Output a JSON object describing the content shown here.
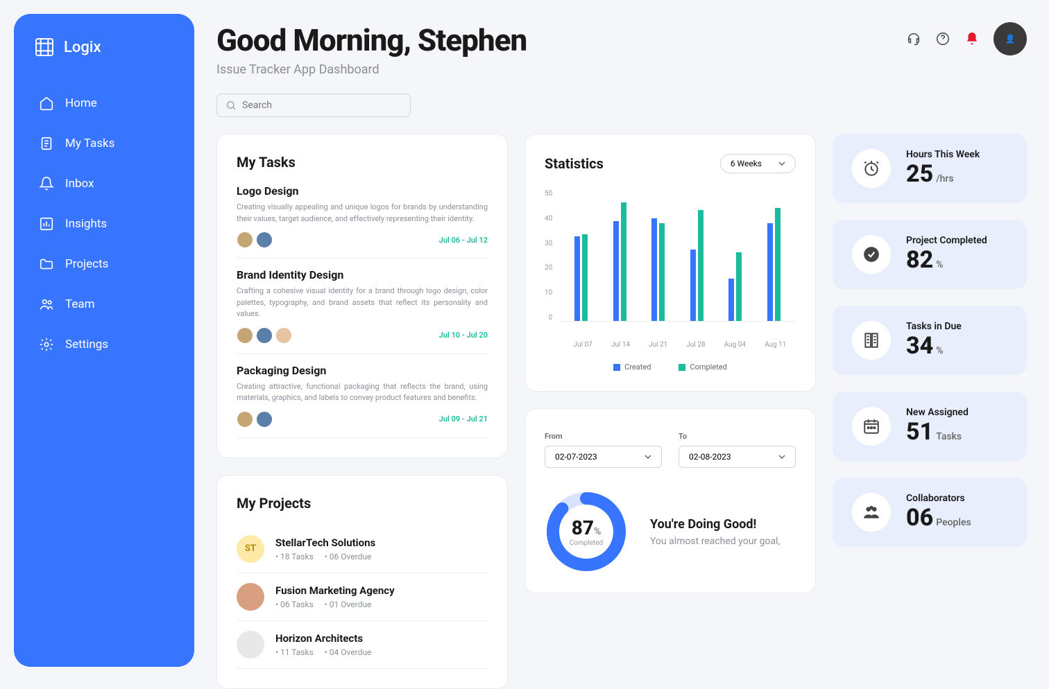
{
  "brand": "Logix",
  "nav": [
    "Home",
    "My Tasks",
    "Inbox",
    "Insights",
    "Projects",
    "Team",
    "Settings"
  ],
  "header": {
    "greeting": "Good Morning, Stephen",
    "subtitle": "Issue Tracker App Dashboard",
    "search_placeholder": "Search"
  },
  "myTasks": {
    "title": "My Tasks",
    "items": [
      {
        "title": "Logo Design",
        "desc": "Creating visually appealing and unique logos for brands by understanding their values, target audience, and effectively representing their identity.",
        "date": "Jul 06 - Jul 12"
      },
      {
        "title": "Brand Identity Design",
        "desc": "Crafting a cohesive visual identity for a brand through logo design, color palettes, typography, and brand assets that reflect its personality and values.",
        "date": "Jul 10 - Jul 20"
      },
      {
        "title": "Packaging Design",
        "desc": "Creating attractive, functional packaging that reflects the brand, using materials, graphics, and labels to convey product features and benefits.",
        "date": "Jul 09 - Jul 21"
      }
    ]
  },
  "myProjects": {
    "title": "My Projects",
    "items": [
      {
        "abbr": "ST",
        "name": "StellarTech Solutions",
        "tasks": "18 Tasks",
        "overdue": "06 Overdue"
      },
      {
        "abbr": "",
        "name": "Fusion Marketing Agency",
        "tasks": "06 Tasks",
        "overdue": "01 Overdue"
      },
      {
        "abbr": "",
        "name": "Horizon Architects",
        "tasks": "11 Tasks",
        "overdue": "04 Overdue"
      }
    ]
  },
  "statistics": {
    "title": "Statistics",
    "range": "6 Weeks",
    "legend": {
      "created": "Created",
      "completed": "Completed"
    }
  },
  "chart_data": {
    "type": "bar",
    "categories": [
      "Jul 07",
      "Jul 14",
      "Jul 21",
      "Jul 28",
      "Aug 04",
      "Aug 11"
    ],
    "series": [
      {
        "name": "Created",
        "values": [
          32,
          38,
          39,
          27,
          16,
          37
        ]
      },
      {
        "name": "Completed",
        "values": [
          33,
          45,
          37,
          42,
          26,
          43
        ]
      }
    ],
    "ylim": [
      0,
      50
    ],
    "yticks": [
      0,
      10,
      20,
      30,
      40,
      50
    ]
  },
  "dateRange": {
    "fromLabel": "From",
    "toLabel": "To",
    "from": "02-07-2023",
    "to": "02-08-2023"
  },
  "goal": {
    "pct": "87",
    "pct_sym": "%",
    "label": "Completed",
    "title": "You're Doing Good!",
    "sub": "You almost reached your goal,"
  },
  "stats": [
    {
      "label": "Hours This Week",
      "val": "25",
      "unit": "/hrs"
    },
    {
      "label": "Project Completed",
      "val": "82",
      "unit": "%"
    },
    {
      "label": "Tasks in Due",
      "val": "34",
      "unit": "%"
    },
    {
      "label": "New Assigned",
      "val": "51",
      "unit": "Tasks"
    },
    {
      "label": "Collaborators",
      "val": "06",
      "unit": "Peoples"
    }
  ]
}
